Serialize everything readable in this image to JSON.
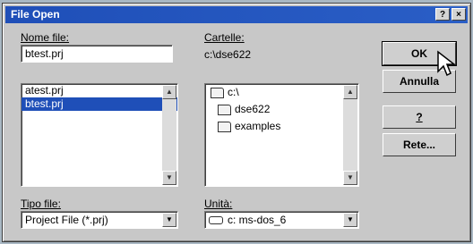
{
  "title": "File Open",
  "titlebar_buttons": {
    "help": "?",
    "close": "×"
  },
  "filename": {
    "label": "Nome file:",
    "value": "btest.prj",
    "files": [
      "atest.prj",
      "btest.prj"
    ],
    "selected_index": 1
  },
  "folders": {
    "label": "Cartelle:",
    "path": "c:\\dse622",
    "items": [
      "c:\\",
      "dse622",
      "examples"
    ]
  },
  "filetype": {
    "label": "Tipo file:",
    "value": "Project File (*.prj)"
  },
  "drive": {
    "label": "Unità:",
    "value": "c: ms-dos_6"
  },
  "buttons": {
    "ok": "OK",
    "cancel": "Annulla",
    "help": "?",
    "network": "Rete..."
  }
}
